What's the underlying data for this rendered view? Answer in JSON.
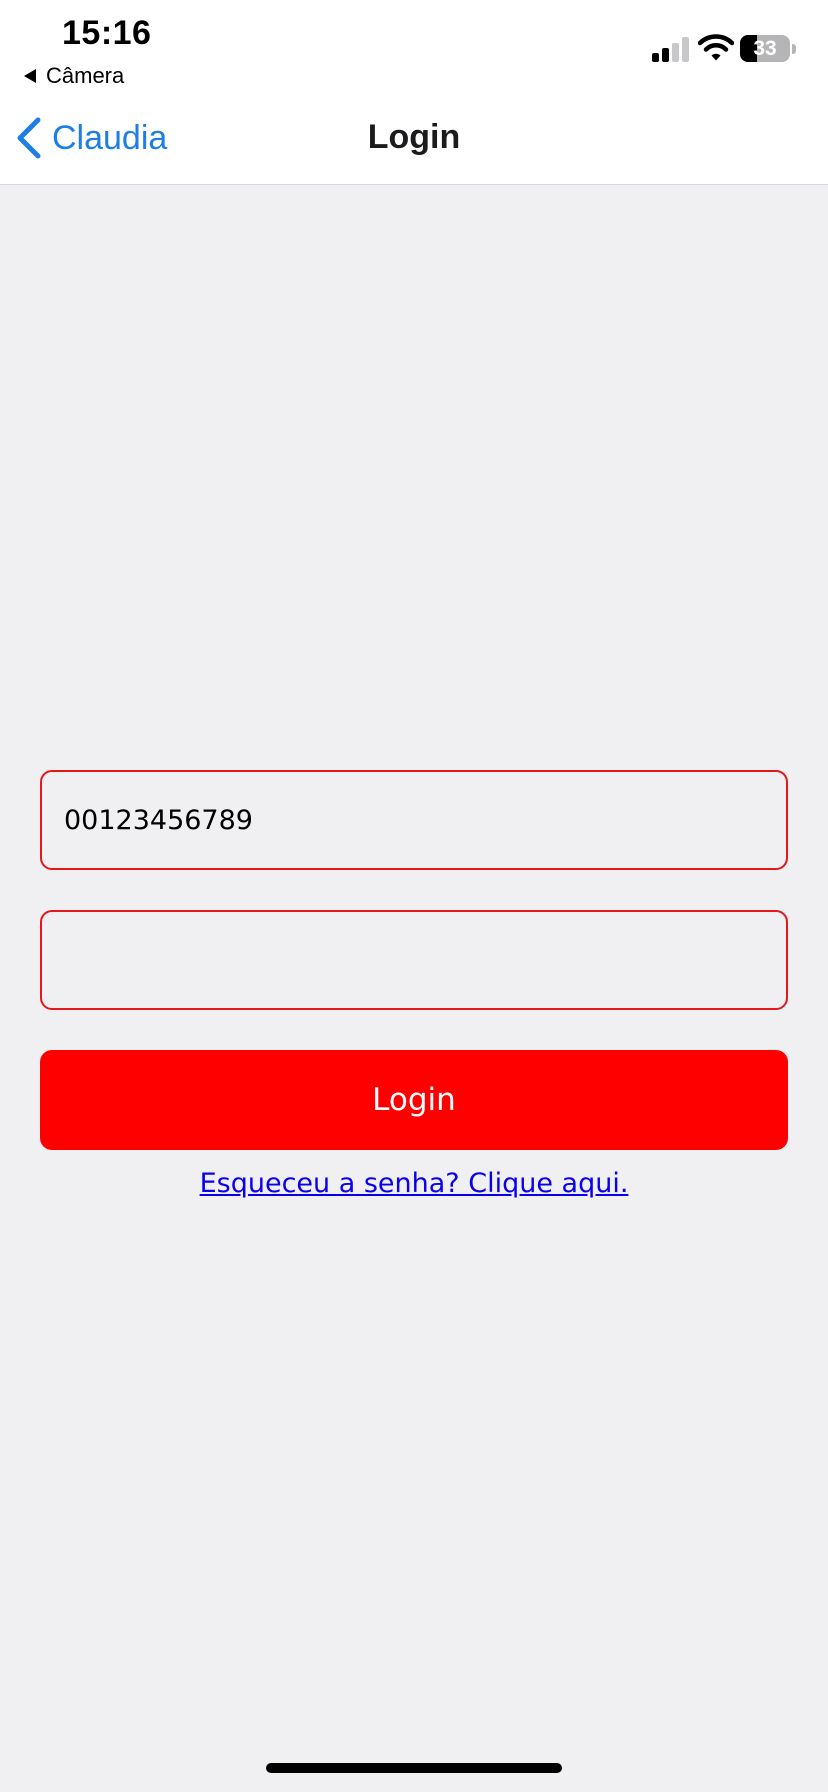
{
  "status_bar": {
    "time": "15:16",
    "back_app_label": "Câmera",
    "battery_level": 33,
    "battery_text": "33",
    "signal_bars_active": 2,
    "signal_bars_total": 4,
    "signal_icon": "cellular-signal-icon",
    "wifi_icon": "wifi-icon"
  },
  "nav": {
    "back_label": "Claudia",
    "title": "Login"
  },
  "form": {
    "username_value": "00123456789",
    "password_value": "",
    "login_label": "Login",
    "forgot_link": "Esqueceu a senha? Clique aqui."
  },
  "colors": {
    "accent_blue": "#1f7ee4",
    "primary_red": "#ff0000",
    "field_border_red": "#e4171b",
    "link_blue": "#0a00ee",
    "background": "#f0eff1"
  }
}
